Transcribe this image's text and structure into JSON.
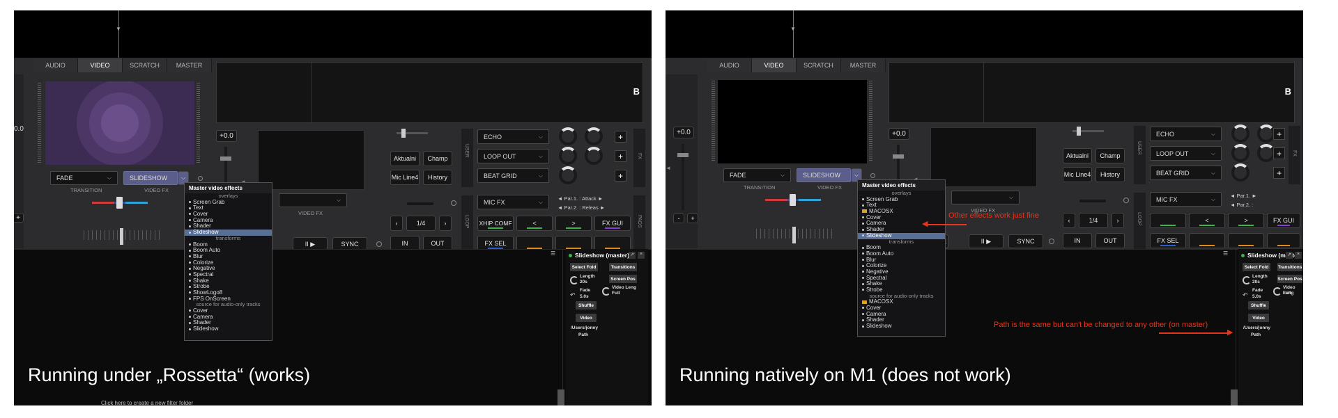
{
  "common": {
    "tabs": [
      "AUDIO",
      "VIDEO",
      "SCRATCH",
      "MASTER"
    ],
    "active_tab": "VIDEO",
    "deck_letter": "B",
    "pitch": "+0.0",
    "transition": "FADE",
    "transition_label": "TRANSITION",
    "video_fx": "SLIDESHOW",
    "video_fx_label": "VIDEO FX",
    "video_fx2_label": "VIDEO FX",
    "pads": [
      "Aktualni",
      "Champ",
      "Mic Line4",
      "History"
    ],
    "user_label": "USER",
    "effects": [
      "ECHO",
      "LOOP OUT",
      "BEAT GRID"
    ],
    "fx_label": "FX",
    "mic_fx": "MIC FX",
    "loop_label": "LOOP",
    "loop_size": "1/4",
    "loop_prev": "<",
    "loop_next": ">",
    "in_label": "IN",
    "out_label": "OUT",
    "sync_label": "SYNC",
    "play_label": "II ▶",
    "pads_label": "PADS",
    "fx_gui": "FX GUI",
    "fx_sel": "FX SEL",
    "slideshow_title": "Slideshow (master)",
    "select_fold": "Select Fold",
    "transitions": "Transitions",
    "screen_pos": "Screen Pos",
    "length_label": "Length",
    "length_value": "20s",
    "fade_label": "Fade",
    "fade_value": "5.0s",
    "video_length_label": "Video Leng",
    "video_length_value": "Full",
    "shuffle": "Shuffle",
    "video": "Video",
    "path_value": "/Users/jonny",
    "path_label": "Path",
    "menu_title": "Master video effects",
    "overlays_label": "overlays",
    "transforms_label": "transforms",
    "audio_only_label": "source for audio-only tracks",
    "colors": {
      "accent_red": "#e8341c",
      "menu_highlight": "#5a6f95",
      "slideshow_dd": "#5b5d8a"
    }
  },
  "left": {
    "caption": "Running under „Rossetta“ (works)",
    "pitch_partial": "0.0",
    "par1": "◄ Par.1. : Attack  ►",
    "par2": "◄ Par.2. : Releas  ►",
    "pad_fx1": "XHIP COMF",
    "pad_fx_arrows": [
      "<",
      ">"
    ],
    "play_partial": "E",
    "overlays": [
      "Screen Grab",
      "Text",
      "Cover",
      "Camera",
      "Shader",
      "Slideshow"
    ],
    "transforms": [
      "Boom",
      "Boom Auto",
      "Blur",
      "Colorize",
      "Negative",
      "Spectral",
      "Shake",
      "Strobe",
      "ShowLogo8",
      "FPS OnScreen"
    ],
    "audio_only": [
      "Cover",
      "Camera",
      "Shader",
      "Slideshow"
    ],
    "footer_text": "Click here to create a new filter folder"
  },
  "right": {
    "caption": "Running natively on M1 (does not work)",
    "par1": "◄   Par.1.  ►",
    "par2": "◄   Par.2. :",
    "pad_fx_arrows": [
      "<",
      ">"
    ],
    "play_partial": "E",
    "overlays_before": [
      "Screen Grab",
      "Text"
    ],
    "overlay_folder": "MACOSX",
    "overlays_after": [
      "Cover",
      "Camera",
      "Shader",
      "Slideshow"
    ],
    "transforms": [
      "Boom",
      "Boom Auto",
      "Blur",
      "Colorize",
      "Negative",
      "Spectral",
      "Shake",
      "Strobe"
    ],
    "audio_folder": "MACOSX",
    "audio_only": [
      "Cover",
      "Camera",
      "Shader",
      "Slideshow"
    ],
    "note_effects": "Other effects work just fine",
    "note_path": "Path is the same but can't be changed to any other (on master)"
  }
}
